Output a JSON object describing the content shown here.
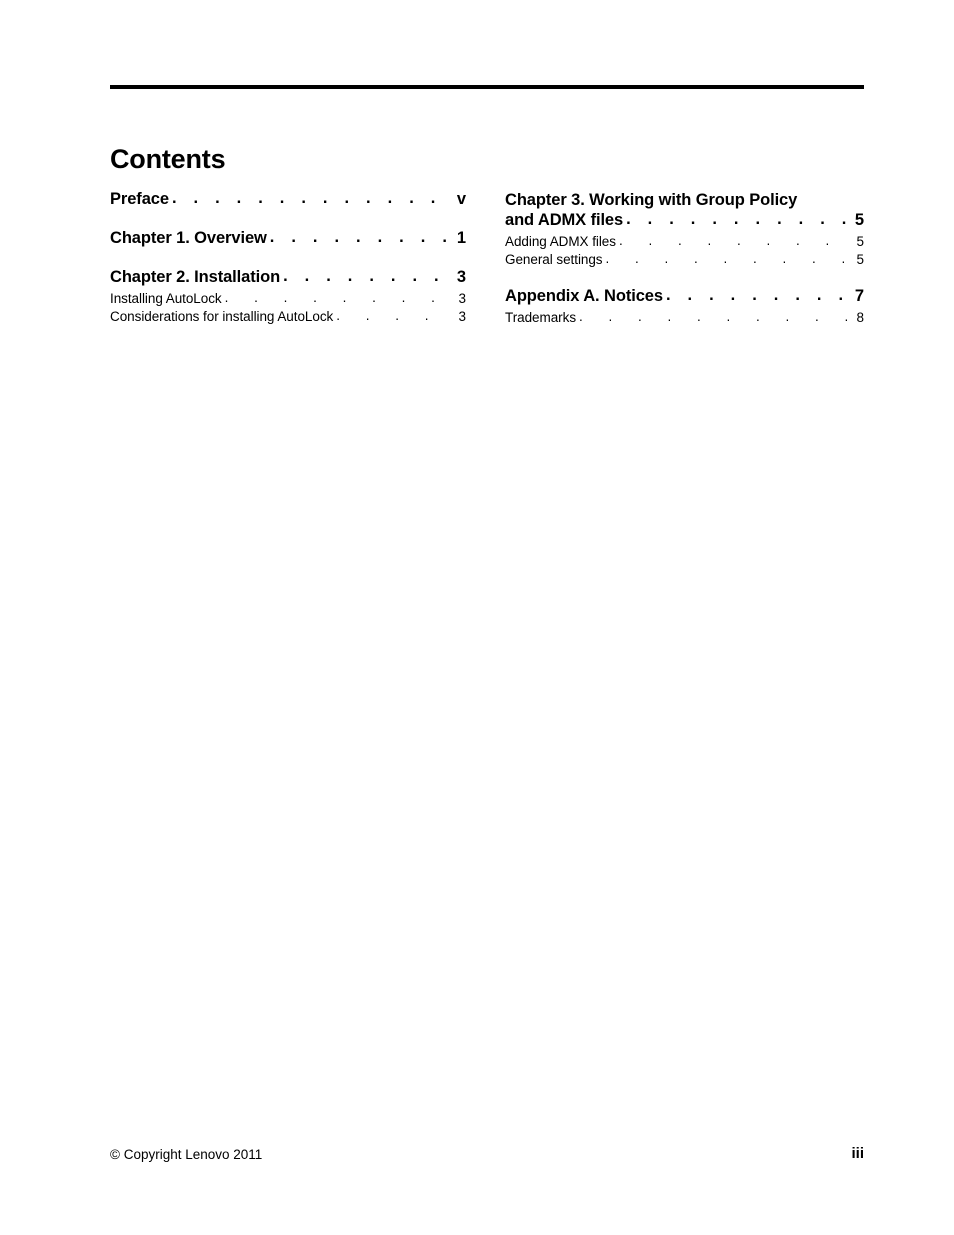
{
  "page": {
    "title": "Contents",
    "footer_copyright": "© Copyright Lenovo 2011",
    "footer_page_number": "iii",
    "leader_dots": ". . . . . . . . . . . . . . . . . . . . . . . . . . . . . . ."
  },
  "toc": {
    "left_column": [
      {
        "label": "Preface",
        "page": "v",
        "level": "chapter"
      },
      {
        "label": "Chapter 1. Overview",
        "page": "1",
        "level": "chapter"
      },
      {
        "label": "Chapter 2. Installation",
        "page": "3",
        "level": "chapter"
      },
      {
        "label": "Installing AutoLock",
        "page": "3",
        "level": "sub"
      },
      {
        "label": "Considerations for installing AutoLock",
        "page": "3",
        "level": "sub"
      }
    ],
    "right_column": [
      {
        "label_line1": "Chapter 3. Working with Group Policy",
        "label_line2": "and ADMX files",
        "page": "5",
        "level": "chapter-wrapped"
      },
      {
        "label": "Adding ADMX files",
        "page": "5",
        "level": "sub"
      },
      {
        "label": "General settings",
        "page": "5",
        "level": "sub"
      },
      {
        "label": "Appendix A. Notices",
        "page": "7",
        "level": "chapter"
      },
      {
        "label": "Trademarks",
        "page": "8",
        "level": "sub"
      }
    ]
  }
}
